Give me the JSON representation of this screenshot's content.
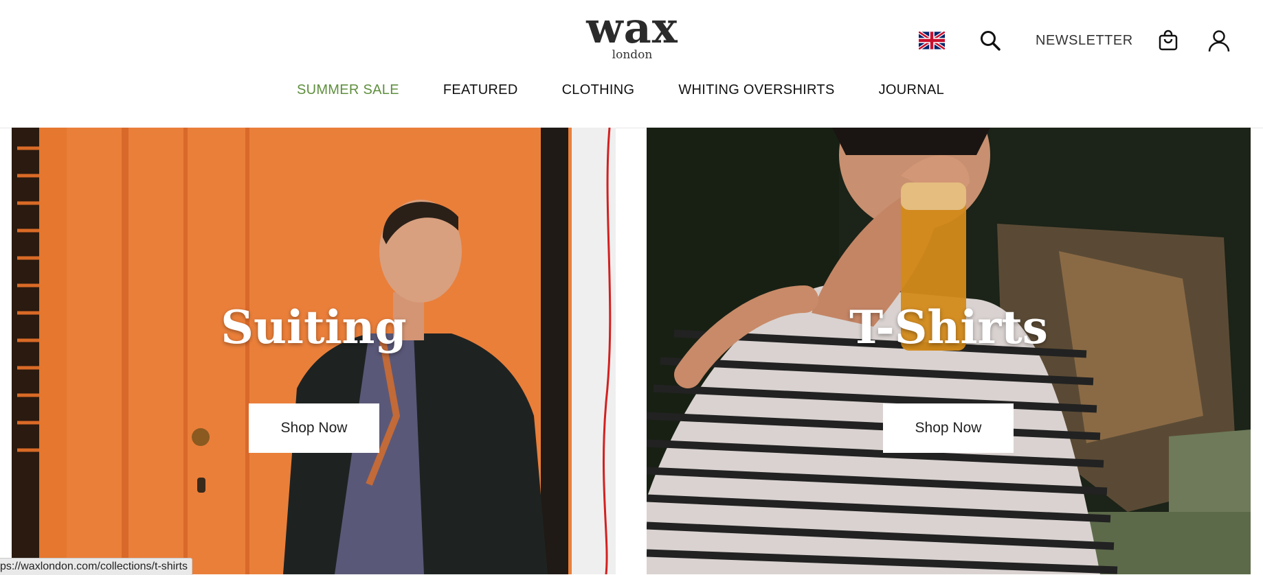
{
  "header": {
    "logo": {
      "word": "wax",
      "sub": "london"
    },
    "utility": {
      "newsletter_label": "NEWSLETTER",
      "icons": [
        "uk-flag-icon",
        "search-icon",
        "cart-icon",
        "account-icon"
      ]
    },
    "nav": {
      "items": [
        {
          "label": "SUMMER SALE",
          "color": "#5f8f3e"
        },
        {
          "label": "FEATURED"
        },
        {
          "label": "CLOTHING"
        },
        {
          "label": "WHITING OVERSHIRTS"
        },
        {
          "label": "JOURNAL"
        }
      ]
    }
  },
  "promos": [
    {
      "title": "Suiting",
      "button": "Shop Now"
    },
    {
      "title": "T-Shirts",
      "button": "Shop Now"
    }
  ],
  "status_bar": {
    "url": "ps://waxlondon.com/collections/t-shirts"
  },
  "colors": {
    "accent_sale": "#5f8f3e",
    "suiting_bg": "#ea7f3a",
    "tshirt_bg": "#1c2318"
  }
}
